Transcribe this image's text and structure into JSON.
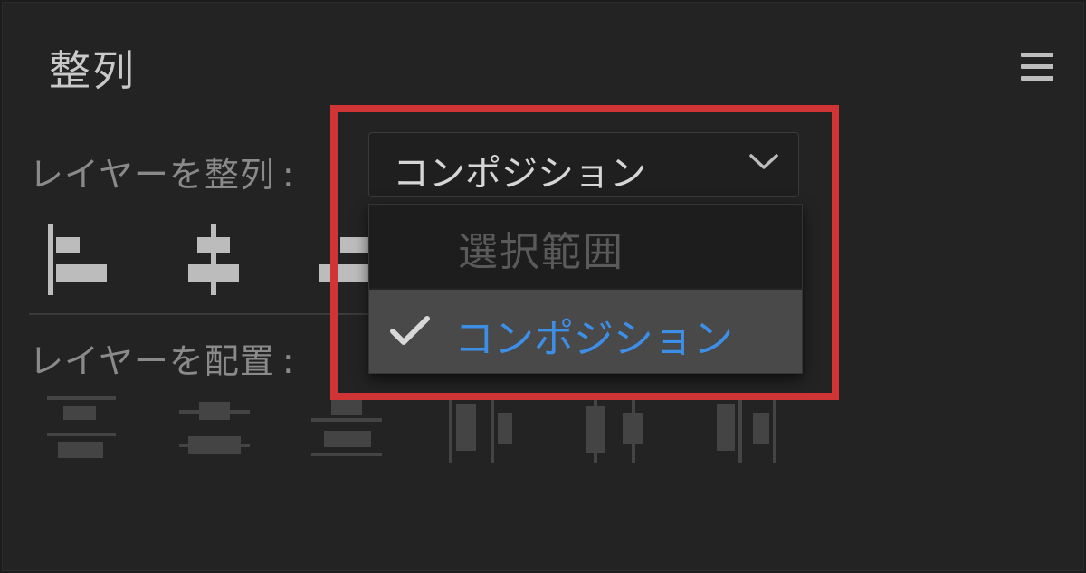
{
  "panel": {
    "title": "整列"
  },
  "align_layers": {
    "label": "レイヤーを整列",
    "colon": ":",
    "select": {
      "selected": "コンポジション",
      "options": [
        {
          "label": "選択範囲",
          "checked": false,
          "disabled": true
        },
        {
          "label": "コンポジション",
          "checked": true,
          "disabled": false
        }
      ]
    },
    "icons": [
      "align-left-icon",
      "align-horizontal-center-icon",
      "align-right-icon"
    ]
  },
  "distribute_layers": {
    "label": "レイヤーを配置",
    "colon": ":",
    "icons": [
      "distribute-top-icon",
      "distribute-vertical-center-icon",
      "distribute-bottom-icon",
      "distribute-left-icon",
      "distribute-horizontal-center-icon",
      "distribute-right-icon"
    ]
  },
  "colors": {
    "accent": "#3d8ee6",
    "highlight_border": "#d13434",
    "panel_bg": "#232323"
  }
}
